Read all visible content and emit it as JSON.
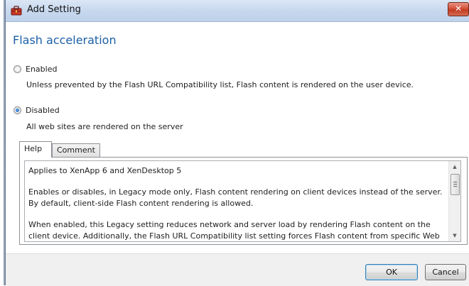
{
  "window": {
    "title": "Add Setting",
    "close_glyph": "✕"
  },
  "setting": {
    "heading": "Flash acceleration"
  },
  "options": [
    {
      "label": "Enabled",
      "description": "Unless prevented by the Flash URL Compatibility list, Flash content is rendered on the user device.",
      "selected": false
    },
    {
      "label": "Disabled",
      "description": "All web sites are rendered on the server",
      "selected": true
    }
  ],
  "tabs": [
    {
      "label": "Help",
      "active": true
    },
    {
      "label": "Comment",
      "active": false
    }
  ],
  "help": {
    "paragraphs": [
      "Applies to XenApp 6 and XenDesktop 5",
      "Enables or disables, in Legacy mode only, Flash content rendering on client devices instead of the server. By default, client-side Flash content rendering is allowed.",
      "When enabled, this Legacy setting reduces network and server load by rendering Flash content on the client device. Additionally, the Flash URL Compatibility list setting forces Flash content from specific Web sites to be"
    ]
  },
  "buttons": {
    "ok": "OK",
    "cancel": "Cancel"
  },
  "icons": {
    "app": "toolbox-icon",
    "close": "close-icon",
    "scroll_up": "scroll-up-arrow-icon",
    "scroll_down": "scroll-down-arrow-icon"
  },
  "colors": {
    "heading": "#1b5fa6",
    "close_button": "#c23b22",
    "titlebar": "#c7d8ee"
  }
}
